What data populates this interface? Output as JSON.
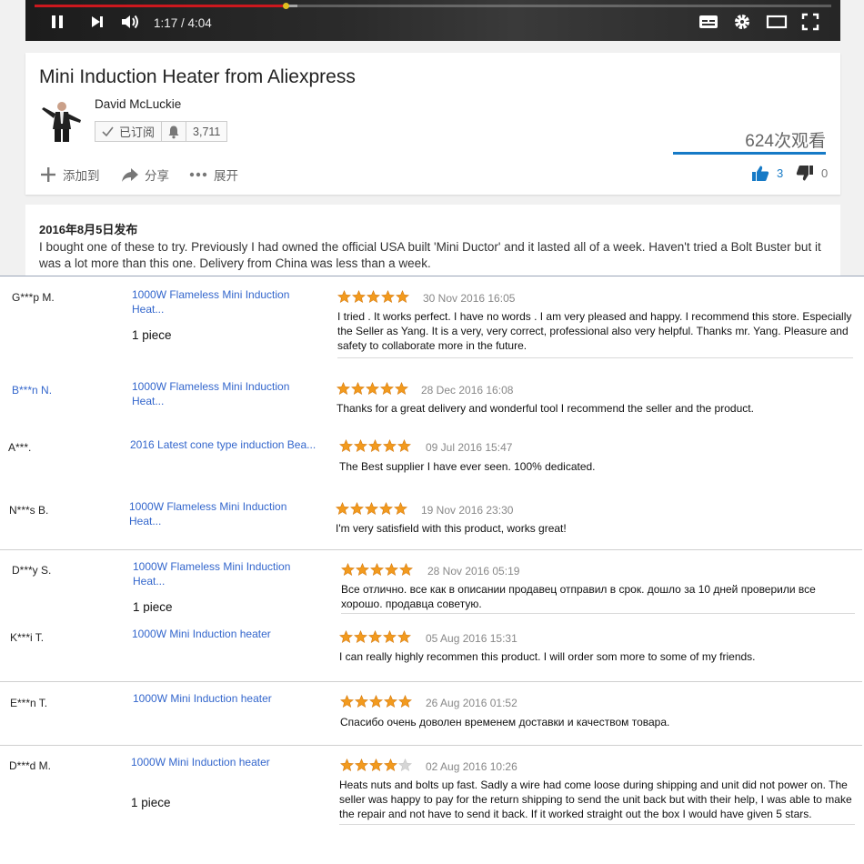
{
  "player": {
    "time": "1:17 / 4:04",
    "progress_percent": 31.5,
    "buffered_percent": 33
  },
  "video": {
    "title": "Mini Induction Heater from Aliexpress",
    "channel": "David McLuckie",
    "subscribed_label": "已订阅",
    "subscriber_count": "3,711",
    "views": "624次观看",
    "add_to_label": "添加到",
    "share_label": "分享",
    "more_label": "展开",
    "likes": "3",
    "dislikes": "0",
    "like_color": "#167ac6"
  },
  "description": {
    "published": "2016年8月5日发布",
    "text": "I bought one of these to try. Previously I had owned the official USA built 'Mini Ductor' and it lasted all of a week. Haven't tried a Bolt Buster but it was a lot more than this one. Delivery from China was less than a week."
  },
  "reviews": [
    {
      "buyer": "G***p M.",
      "product": "1000W Flameless Mini Induction Heat...",
      "qty": "1 piece",
      "stars": 5,
      "date": "30 Nov 2016 16:05",
      "text": "I tried . It works perfect. I have no words . I am very pleased and happy. I recommend this store. Especially the Seller as Yang. It is a very, very correct, professional also very helpful. Thanks mr. Yang. Pleasure and safety to collaborate more in the future."
    },
    {
      "buyer": "B***n N.",
      "product": "1000W Flameless Mini Induction Heat...",
      "qty": "",
      "stars": 5,
      "date": "28 Dec 2016 16:08",
      "text": "Thanks for a great delivery and wonderful tool I recommend the seller and the product."
    },
    {
      "buyer": "A***.",
      "product": "2016 Latest cone type induction Bea...",
      "qty": "",
      "stars": 5,
      "date": "09 Jul 2016 15:47",
      "text": "The Best supplier I have ever seen. 100% dedicated."
    },
    {
      "buyer": "N***s B.",
      "product": "1000W Flameless Mini Induction Heat...",
      "qty": "",
      "stars": 5,
      "date": "19 Nov 2016 23:30",
      "text": "I'm very satisfield with this product, works great!"
    },
    {
      "buyer": "D***y S.",
      "product": "1000W Flameless Mini Induction Heat...",
      "qty": "1 piece",
      "stars": 5,
      "date": "28 Nov 2016 05:19",
      "text": "Все отлично. все как в описании продавец отправил в срок. дошло за 10 дней проверили все хорошо. продавца советую."
    },
    {
      "buyer": "K***i T.",
      "product": "1000W Mini Induction heater",
      "qty": "",
      "stars": 5,
      "date": "05 Aug 2016 15:31",
      "text": "I can really highly recommen this product. I will order som more to some of my friends."
    },
    {
      "buyer": "E***n T.",
      "product": "1000W Mini Induction heater",
      "qty": "",
      "stars": 5,
      "date": "26 Aug 2016 01:52",
      "text": "Спасибо очень доволен временем доставки и качеством товара."
    },
    {
      "buyer": "D***d M.",
      "product": "1000W Mini Induction heater",
      "qty": "1 piece",
      "stars": 4,
      "date": "02 Aug 2016 10:26",
      "text": "Heats nuts and bolts up fast. Sadly a wire had come loose during shipping and unit did not power on. The seller was happy to pay for the return shipping to send the unit back but with their help, I was able to make the repair and not have to send it back. If it worked straight out the box I would have given 5 stars."
    }
  ],
  "colors": {
    "star_full": "#f29a1e",
    "star_empty": "#d6d6d6",
    "link": "#3366cc",
    "accent": "#cc181e"
  }
}
